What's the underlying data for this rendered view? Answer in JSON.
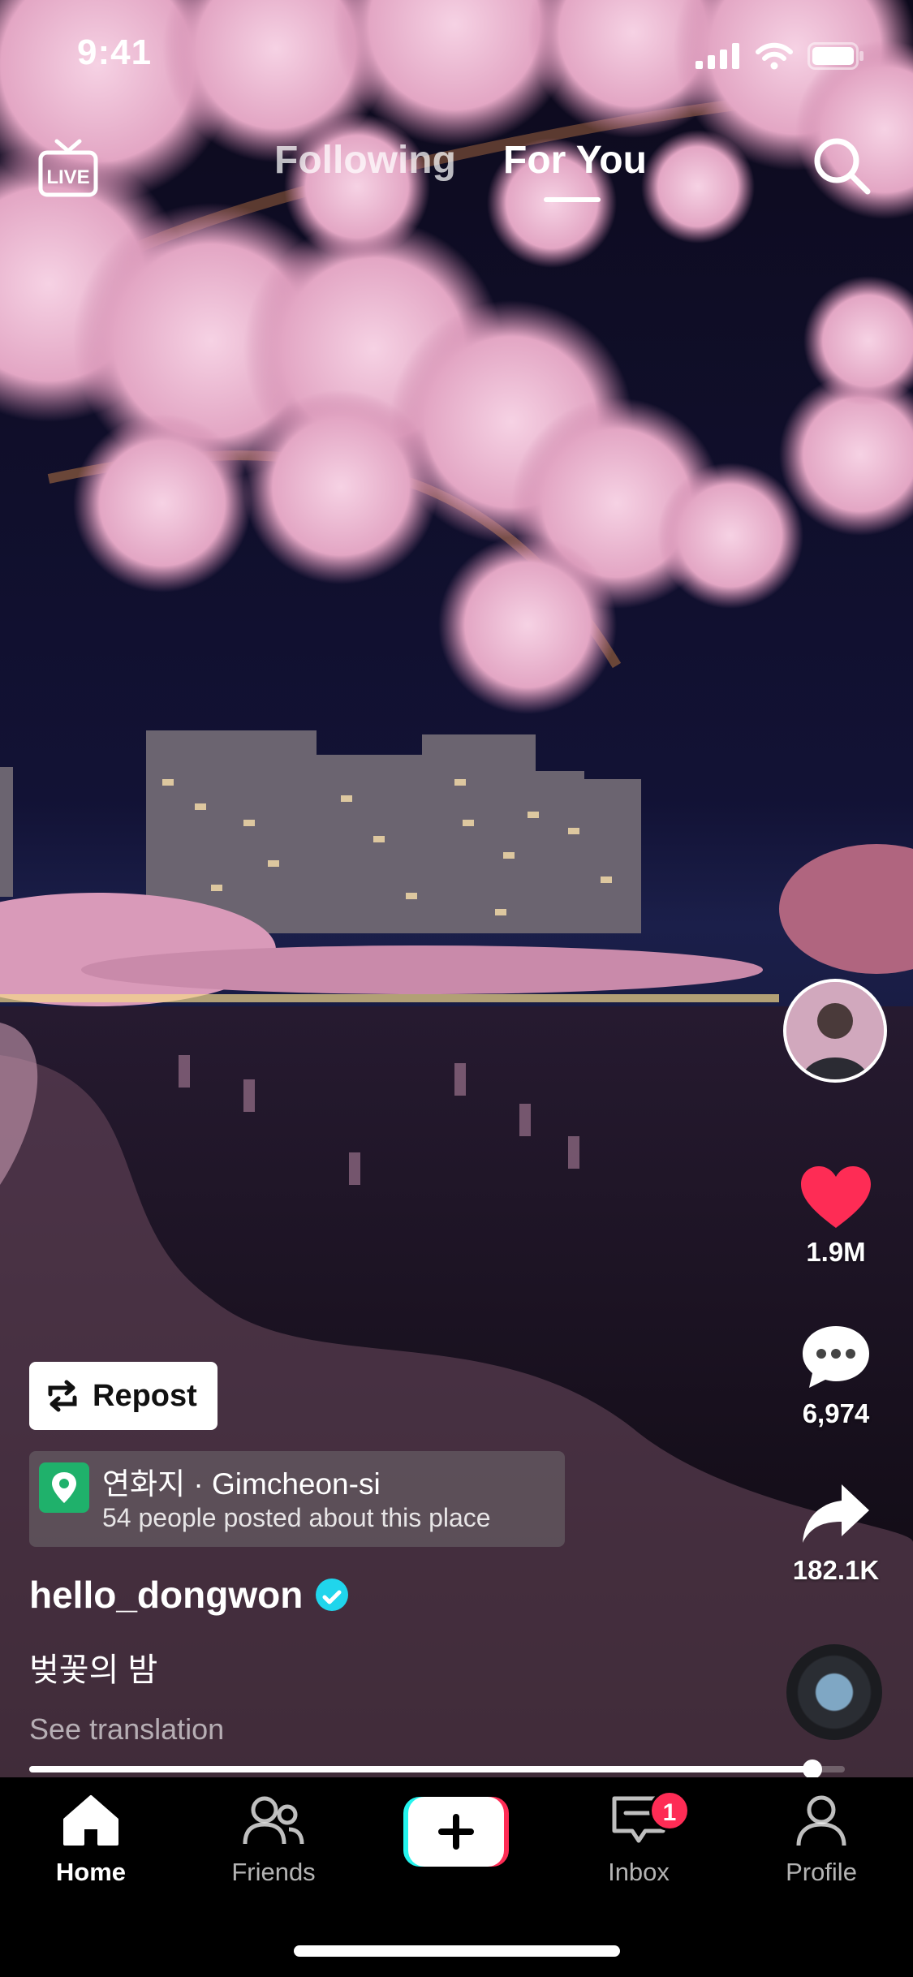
{
  "status_bar": {
    "time": "9:41"
  },
  "top_nav": {
    "live_label": "LIVE",
    "tabs": [
      {
        "label": "Following",
        "active": false
      },
      {
        "label": "For You",
        "active": true
      }
    ]
  },
  "actions": {
    "likes": "1.9M",
    "comments": "6,974",
    "shares": "182.1K"
  },
  "post": {
    "repost_label": "Repost",
    "location_name": "연화지 · Gimcheon-si",
    "location_sub": "54 people posted about this place",
    "username": "hello_dongwon",
    "verified": true,
    "caption": "벚꽃의 밤",
    "see_translation": "See translation",
    "progress": 0.96
  },
  "bottom_nav": {
    "items": [
      {
        "label": "Home",
        "icon": "home-icon",
        "active": true
      },
      {
        "label": "Friends",
        "icon": "friends-icon",
        "active": false
      },
      {
        "label": "Inbox",
        "icon": "inbox-icon",
        "active": false,
        "badge": "1"
      },
      {
        "label": "Profile",
        "icon": "profile-icon",
        "active": false
      }
    ]
  },
  "colors": {
    "like": "#fe2c55",
    "accent_cyan": "#25f4ee",
    "accent_red": "#fe2c55",
    "verified": "#20d5ec",
    "location_pin": "#1fb16b"
  }
}
